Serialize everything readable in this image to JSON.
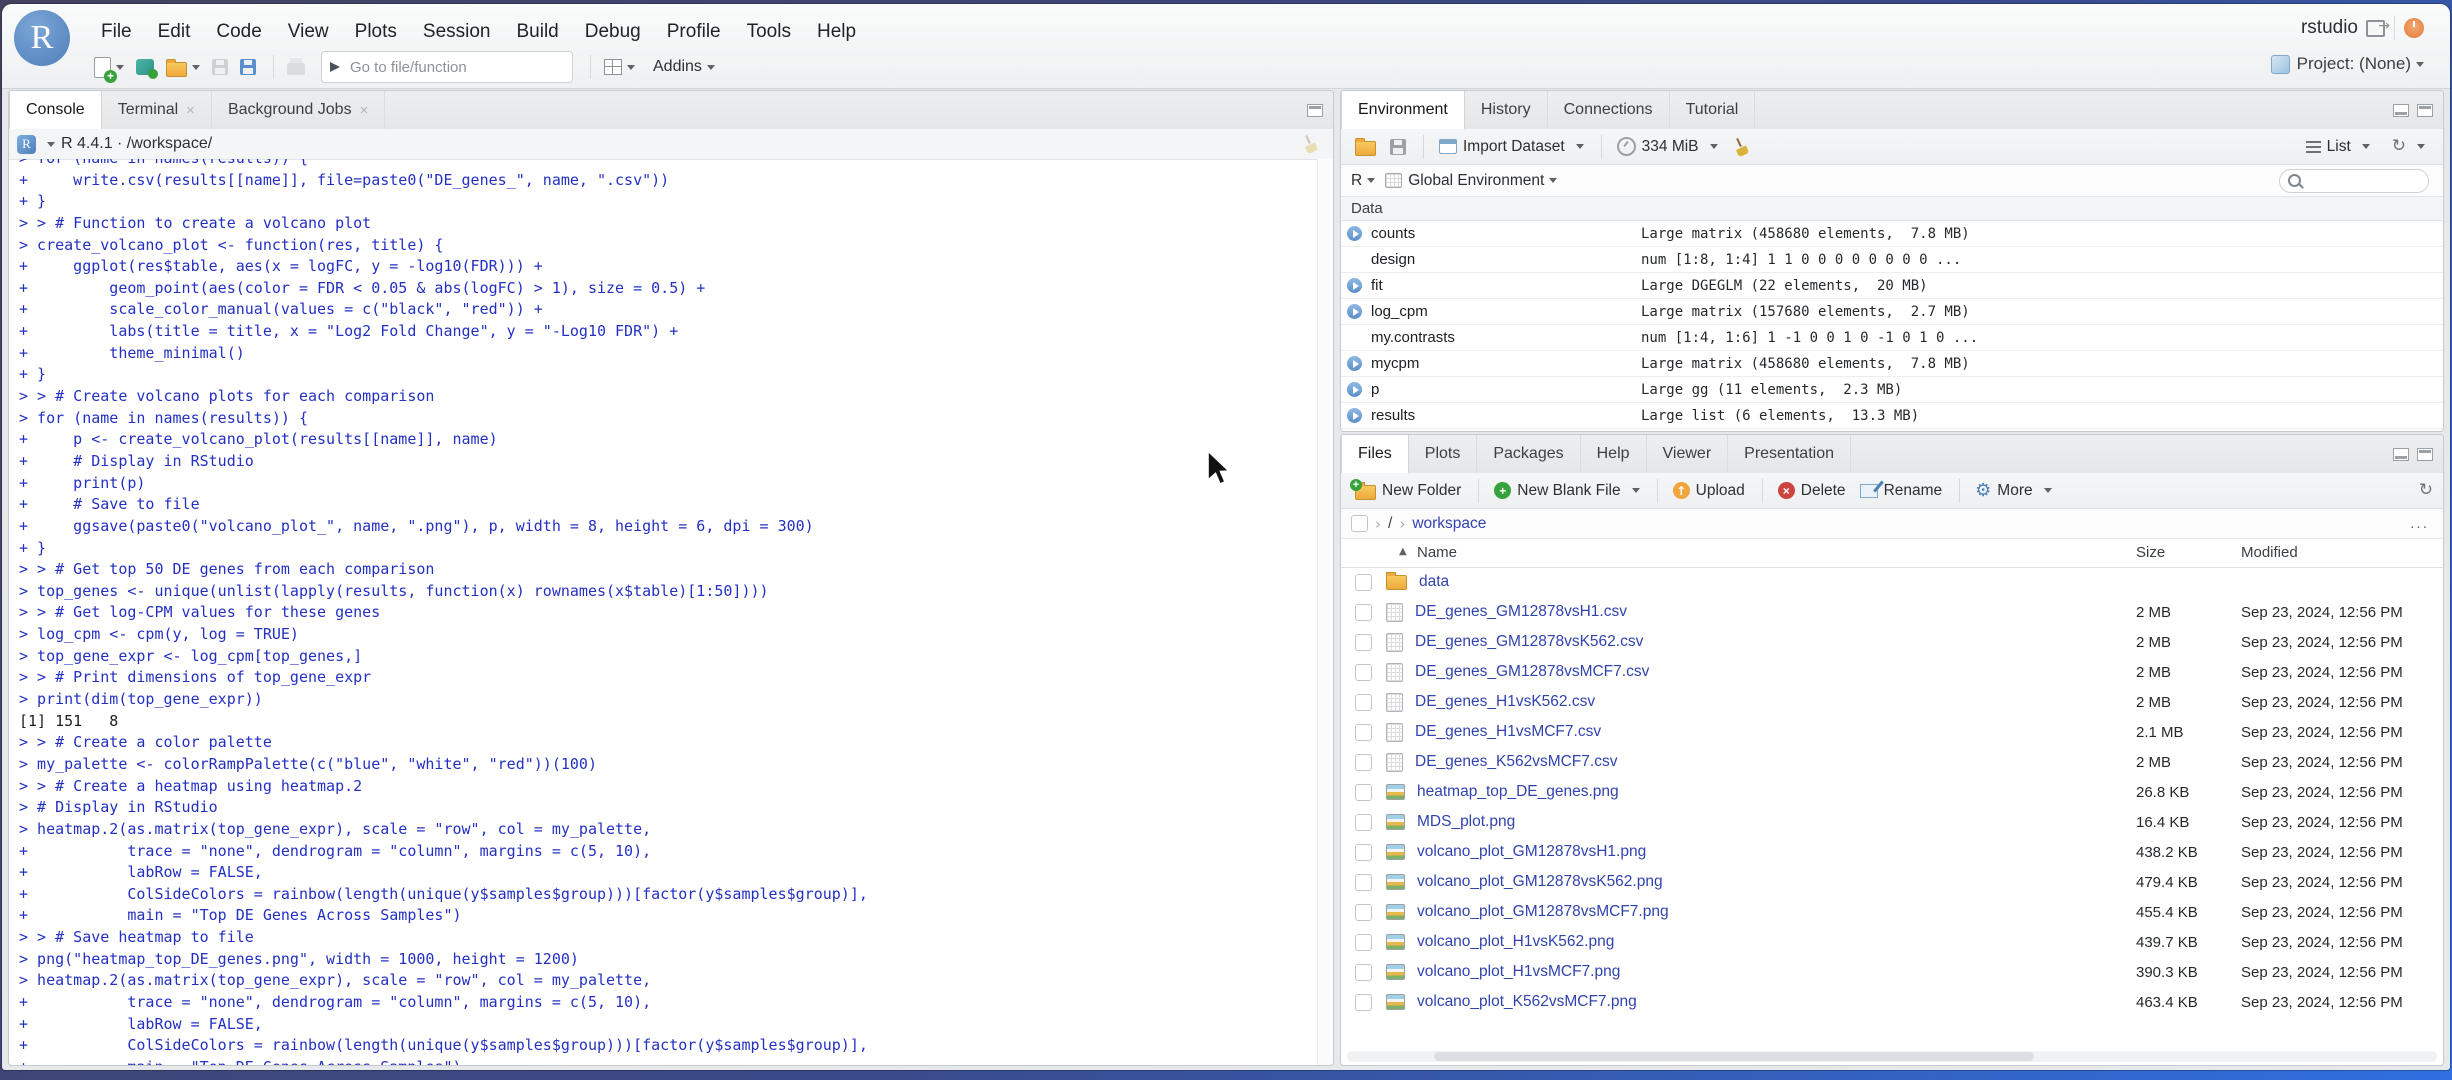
{
  "brand": {
    "r_logo": "R"
  },
  "titlebar": {
    "app": "rstudio",
    "project": "Project: (None)"
  },
  "menubar": {
    "items": [
      "File",
      "Edit",
      "Code",
      "View",
      "Plots",
      "Session",
      "Build",
      "Debug",
      "Profile",
      "Tools",
      "Help"
    ]
  },
  "toolbar": {
    "goto_placeholder": "Go to file/function",
    "addins_label": "Addins"
  },
  "console": {
    "tabs": [
      {
        "label": "Console",
        "close": ""
      },
      {
        "label": "Terminal",
        "close": "×"
      },
      {
        "label": "Background Jobs",
        "close": "×"
      }
    ],
    "runtime": "R 4.4.1 · /workspace/",
    "lines": [
      {
        "t": "> for (name in names(results)) {",
        "k": "in"
      },
      {
        "t": "+     write.csv(results[[name]], file=paste0(\"DE_genes_\", name, \".csv\"))",
        "k": "in"
      },
      {
        "t": "+ }",
        "k": "in"
      },
      {
        "t": "> > # Function to create a volcano plot",
        "k": "in"
      },
      {
        "t": "> create_volcano_plot <- function(res, title) {",
        "k": "in"
      },
      {
        "t": "+     ggplot(res$table, aes(x = logFC, y = -log10(FDR))) +",
        "k": "in"
      },
      {
        "t": "+         geom_point(aes(color = FDR < 0.05 & abs(logFC) > 1), size = 0.5) +",
        "k": "in"
      },
      {
        "t": "+         scale_color_manual(values = c(\"black\", \"red\")) +",
        "k": "in"
      },
      {
        "t": "+         labs(title = title, x = \"Log2 Fold Change\", y = \"-Log10 FDR\") +",
        "k": "in"
      },
      {
        "t": "+         theme_minimal()",
        "k": "in"
      },
      {
        "t": "+ }",
        "k": "in"
      },
      {
        "t": "> > # Create volcano plots for each comparison",
        "k": "in"
      },
      {
        "t": "> for (name in names(results)) {",
        "k": "in"
      },
      {
        "t": "+     p <- create_volcano_plot(results[[name]], name)",
        "k": "in"
      },
      {
        "t": "+     # Display in RStudio",
        "k": "in"
      },
      {
        "t": "+     print(p)",
        "k": "in"
      },
      {
        "t": "+     # Save to file",
        "k": "in"
      },
      {
        "t": "+     ggsave(paste0(\"volcano_plot_\", name, \".png\"), p, width = 8, height = 6, dpi = 300)",
        "k": "in"
      },
      {
        "t": "+ }",
        "k": "in"
      },
      {
        "t": "> > # Get top 50 DE genes from each comparison",
        "k": "in"
      },
      {
        "t": "> top_genes <- unique(unlist(lapply(results, function(x) rownames(x$table)[1:50])))",
        "k": "in"
      },
      {
        "t": "> > # Get log-CPM values for these genes",
        "k": "in"
      },
      {
        "t": "> log_cpm <- cpm(y, log = TRUE)",
        "k": "in"
      },
      {
        "t": "> top_gene_expr <- log_cpm[top_genes,]",
        "k": "in"
      },
      {
        "t": "> > # Print dimensions of top_gene_expr",
        "k": "in"
      },
      {
        "t": "> print(dim(top_gene_expr))",
        "k": "in"
      },
      {
        "t": "[1] 151   8",
        "k": "out"
      },
      {
        "t": "> > # Create a color palette",
        "k": "in"
      },
      {
        "t": "> my_palette <- colorRampPalette(c(\"blue\", \"white\", \"red\"))(100)",
        "k": "in"
      },
      {
        "t": "> > # Create a heatmap using heatmap.2",
        "k": "in"
      },
      {
        "t": "> # Display in RStudio",
        "k": "in"
      },
      {
        "t": "> heatmap.2(as.matrix(top_gene_expr), scale = \"row\", col = my_palette,",
        "k": "in"
      },
      {
        "t": "+           trace = \"none\", dendrogram = \"column\", margins = c(5, 10),",
        "k": "in"
      },
      {
        "t": "+           labRow = FALSE,",
        "k": "in"
      },
      {
        "t": "+           ColSideColors = rainbow(length(unique(y$samples$group)))[factor(y$samples$group)],",
        "k": "in"
      },
      {
        "t": "+           main = \"Top DE Genes Across Samples\")",
        "k": "in"
      },
      {
        "t": "> > # Save heatmap to file",
        "k": "in"
      },
      {
        "t": "> png(\"heatmap_top_DE_genes.png\", width = 1000, height = 1200)",
        "k": "in"
      },
      {
        "t": "> heatmap.2(as.matrix(top_gene_expr), scale = \"row\", col = my_palette,",
        "k": "in"
      },
      {
        "t": "+           trace = \"none\", dendrogram = \"column\", margins = c(5, 10),",
        "k": "in"
      },
      {
        "t": "+           labRow = FALSE,",
        "k": "in"
      },
      {
        "t": "+           ColSideColors = rainbow(length(unique(y$samples$group)))[factor(y$samples$group)],",
        "k": "in"
      },
      {
        "t": "+           main = \"Top DE Genes Across Samples\")",
        "k": "in"
      }
    ]
  },
  "environment": {
    "tabs": [
      {
        "label": "Environment"
      },
      {
        "label": "History"
      },
      {
        "label": "Connections"
      },
      {
        "label": "Tutorial"
      }
    ],
    "toolbar": {
      "import_label": "Import Dataset",
      "memory_label": "334 MiB",
      "list_label": "List"
    },
    "scope_row": {
      "lang": "R",
      "scope": "Global Environment"
    },
    "section_label": "Data",
    "items": [
      {
        "name": "counts",
        "value": "Large matrix (458680 elements,  7.8 MB)",
        "arrow": "on",
        "action": "grid"
      },
      {
        "name": "design",
        "value": "num [1:8, 1:4] 1 1 0 0 0 0 0 0 0 0 ...",
        "arrow": "off",
        "action": "grid"
      },
      {
        "name": "fit",
        "value": "Large DGEGLM (22 elements,  20 MB)",
        "arrow": "on",
        "action": "mag"
      },
      {
        "name": "log_cpm",
        "value": "Large matrix (157680 elements,  2.7 MB)",
        "arrow": "on",
        "action": "grid"
      },
      {
        "name": "my.contrasts",
        "value": "num [1:4, 1:6] 1 -1 0 0 1 0 -1 0 1 0 ...",
        "arrow": "off",
        "action": "grid"
      },
      {
        "name": "mycpm",
        "value": "Large matrix (458680 elements,  7.8 MB)",
        "arrow": "on",
        "action": "grid"
      },
      {
        "name": "p",
        "value": "Large gg (11 elements,  2.3 MB)",
        "arrow": "on",
        "action": "mag"
      },
      {
        "name": "results",
        "value": "Large list (6 elements,  13.3 MB)",
        "arrow": "on",
        "action": "mag"
      }
    ]
  },
  "files": {
    "tabs": [
      {
        "label": "Files"
      },
      {
        "label": "Plots"
      },
      {
        "label": "Packages"
      },
      {
        "label": "Help"
      },
      {
        "label": "Viewer"
      },
      {
        "label": "Presentation"
      }
    ],
    "toolbar": {
      "new_folder": "New Folder",
      "new_blank_file": "New Blank File",
      "upload": "Upload",
      "delete": "Delete",
      "rename": "Rename",
      "more": "More"
    },
    "breadcrumb": {
      "root": "/",
      "folder": "workspace",
      "more": "..."
    },
    "columns": {
      "name": "Name",
      "size": "Size",
      "modified": "Modified"
    },
    "rows": [
      {
        "type": "folder",
        "name": "data",
        "size": "",
        "modified": ""
      },
      {
        "type": "csv",
        "name": "DE_genes_GM12878vsH1.csv",
        "size": "2 MB",
        "modified": "Sep 23, 2024, 12:56 PM"
      },
      {
        "type": "csv",
        "name": "DE_genes_GM12878vsK562.csv",
        "size": "2 MB",
        "modified": "Sep 23, 2024, 12:56 PM"
      },
      {
        "type": "csv",
        "name": "DE_genes_GM12878vsMCF7.csv",
        "size": "2 MB",
        "modified": "Sep 23, 2024, 12:56 PM"
      },
      {
        "type": "csv",
        "name": "DE_genes_H1vsK562.csv",
        "size": "2 MB",
        "modified": "Sep 23, 2024, 12:56 PM"
      },
      {
        "type": "csv",
        "name": "DE_genes_H1vsMCF7.csv",
        "size": "2.1 MB",
        "modified": "Sep 23, 2024, 12:56 PM"
      },
      {
        "type": "csv",
        "name": "DE_genes_K562vsMCF7.csv",
        "size": "2 MB",
        "modified": "Sep 23, 2024, 12:56 PM"
      },
      {
        "type": "img",
        "name": "heatmap_top_DE_genes.png",
        "size": "26.8 KB",
        "modified": "Sep 23, 2024, 12:56 PM"
      },
      {
        "type": "img",
        "name": "MDS_plot.png",
        "size": "16.4 KB",
        "modified": "Sep 23, 2024, 12:56 PM"
      },
      {
        "type": "img",
        "name": "volcano_plot_GM12878vsH1.png",
        "size": "438.2 KB",
        "modified": "Sep 23, 2024, 12:56 PM"
      },
      {
        "type": "img",
        "name": "volcano_plot_GM12878vsK562.png",
        "size": "479.4 KB",
        "modified": "Sep 23, 2024, 12:56 PM"
      },
      {
        "type": "img",
        "name": "volcano_plot_GM12878vsMCF7.png",
        "size": "455.4 KB",
        "modified": "Sep 23, 2024, 12:56 PM"
      },
      {
        "type": "img",
        "name": "volcano_plot_H1vsK562.png",
        "size": "439.7 KB",
        "modified": "Sep 23, 2024, 12:56 PM"
      },
      {
        "type": "img",
        "name": "volcano_plot_H1vsMCF7.png",
        "size": "390.3 KB",
        "modified": "Sep 23, 2024, 12:56 PM"
      },
      {
        "type": "img",
        "name": "volcano_plot_K562vsMCF7.png",
        "size": "463.4 KB",
        "modified": "Sep 23, 2024, 12:56 PM"
      }
    ]
  }
}
